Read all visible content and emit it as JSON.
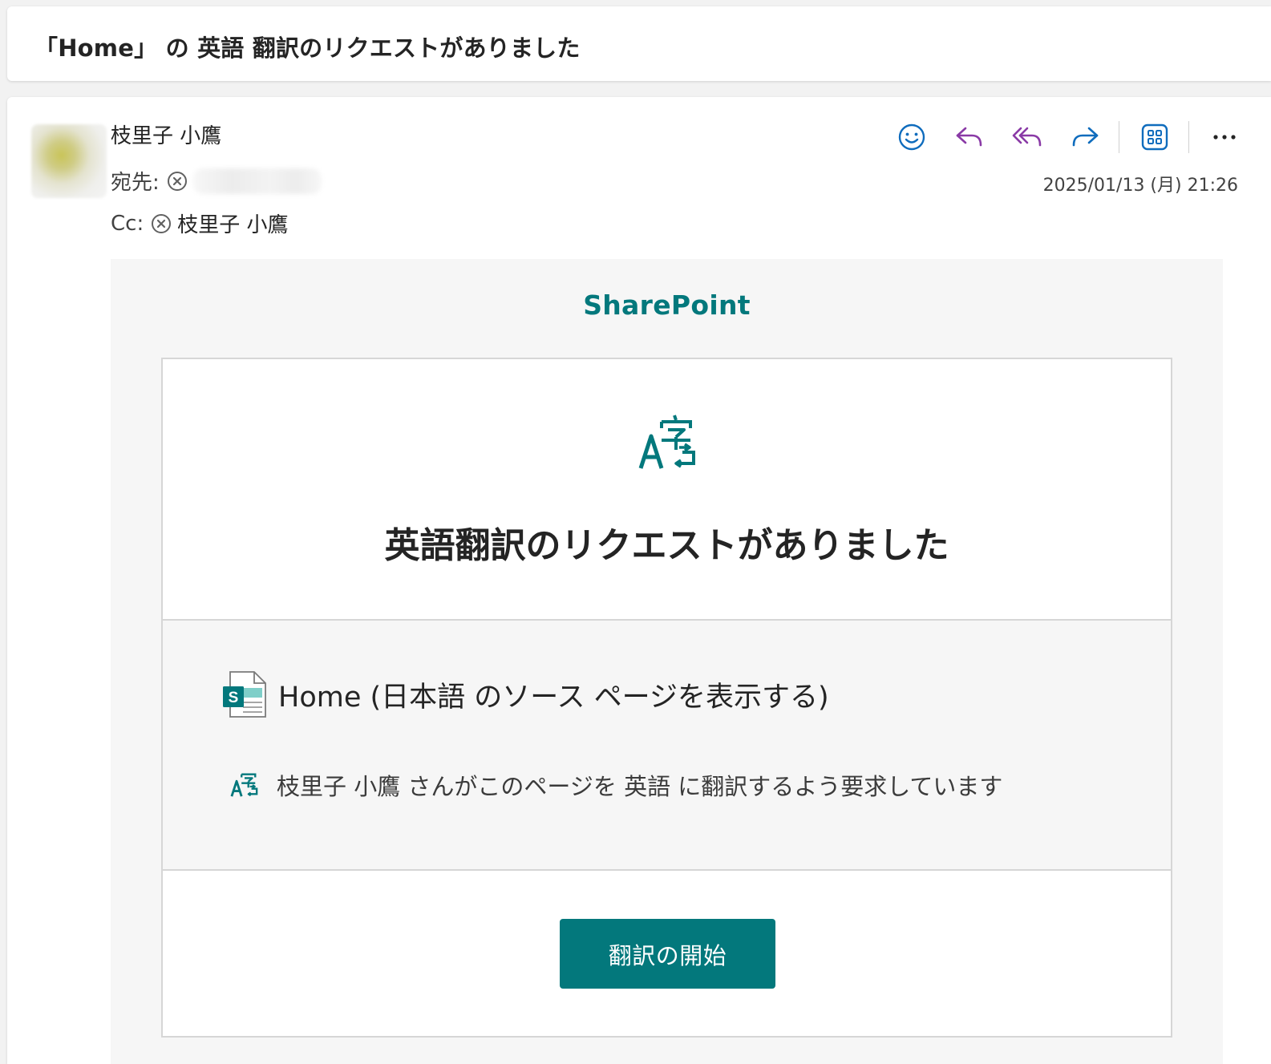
{
  "subject": "「Home」 の 英語 翻訳のリクエストがありました",
  "header": {
    "sender": "枝里子 小鷹",
    "to_label": "宛先:",
    "cc_label": "Cc:",
    "cc_name": "枝里子 小鷹",
    "timestamp": "2025/01/13 (月) 21:26"
  },
  "actions": [
    "smiley-icon",
    "reply-icon",
    "reply-all-icon",
    "forward-icon",
    "apps-icon",
    "more-icon"
  ],
  "colors": {
    "brand": "#03787c",
    "action_icon_blue": "#0f6cbd",
    "action_icon_purple": "#8a3aa6"
  },
  "email_body": {
    "brand_name": "SharePoint",
    "title": "英語翻訳のリクエストがありました",
    "page_link": "Home (日本語 のソース ページを表示する)",
    "request_text": "枝里子 小鷹 さんがこのページを 英語 に翻訳するよう要求しています",
    "button_label": "翻訳の開始"
  }
}
